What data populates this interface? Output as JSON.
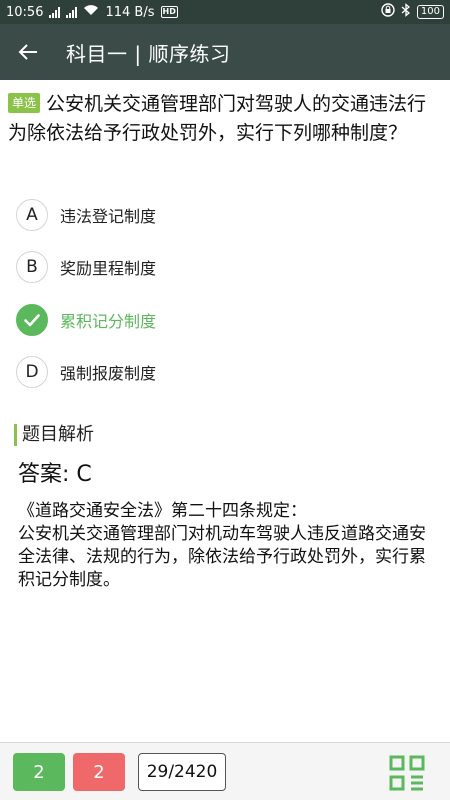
{
  "status_bar": {
    "time": "10:56",
    "speed": "114 B/s",
    "network_badge": "HD",
    "battery": "100"
  },
  "app_bar": {
    "title": "科目一 | 顺序练习",
    "back_icon": "arrow-left-icon"
  },
  "question": {
    "type_badge": "单选",
    "text": "公安机关交通管理部门对驾驶人的交通违法行为除依法给予行政处罚外，实行下列哪种制度？"
  },
  "options": [
    {
      "letter": "A",
      "text": "违法登记制度",
      "state": "normal"
    },
    {
      "letter": "B",
      "text": "奖励里程制度",
      "state": "normal"
    },
    {
      "letter": "C",
      "text": "累积记分制度",
      "state": "correct"
    },
    {
      "letter": "D",
      "text": "强制报废制度",
      "state": "normal"
    }
  ],
  "analysis": {
    "title": "题目解析",
    "answer": "答案: C",
    "explanation": "《道路交通安全法》第二十四条规定：\n公安机关交通管理部门对机动车驾驶人违反道路交通安全法律、法规的行为，除依法给予行政处罚外，实行累积记分制度。"
  },
  "bottom_bar": {
    "right_count": "2",
    "wrong_count": "2",
    "progress": "29/2420",
    "grid_icon": "answer-sheet-grid-icon"
  },
  "colors": {
    "status_bar_bg": "#2f3f3a",
    "app_bar_bg": "#3b4b47",
    "accent_green": "#5cb85c",
    "badge_green": "#8bc34a",
    "wrong_red": "#f0696a"
  }
}
